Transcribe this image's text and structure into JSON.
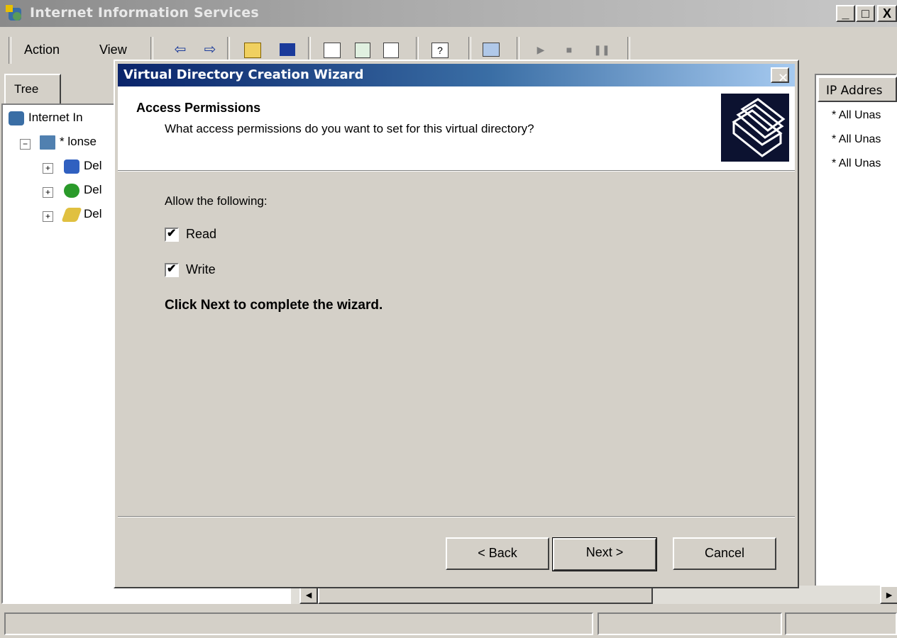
{
  "main_window": {
    "title": "Internet Information Services",
    "controls": {
      "minimize": "_",
      "maximize": "□",
      "close": "X"
    }
  },
  "menu": [
    {
      "label": "Action"
    },
    {
      "label": "View"
    }
  ],
  "toolbar_icons": [
    "back-arrow-icon",
    "forward-arrow-icon",
    "up-folder-icon",
    "show-hide-tree-icon",
    "properties-icon",
    "refresh-icon",
    "export-list-icon",
    "help-icon",
    "computer-icon",
    "play-icon",
    "stop-icon",
    "pause-icon"
  ],
  "tree": {
    "tab_label": "Tree",
    "items": [
      {
        "label": "Internet In",
        "icon": "iis-icon"
      },
      {
        "label": "* lonse",
        "icon": "computer-icon"
      },
      {
        "label": "Del",
        "icon": "ftp-site-icon"
      },
      {
        "label": "Del",
        "icon": "web-site-icon"
      },
      {
        "label": "Del",
        "icon": "smtp-icon"
      }
    ]
  },
  "list": {
    "header": "IP Addres",
    "rows": [
      "* All Unas",
      "* All Unas",
      "* All Unas"
    ]
  },
  "dialog": {
    "title": "Virtual Directory Creation Wizard",
    "close": "✕",
    "heading": "Access Permissions",
    "subheading": "What access permissions do you want to set for this virtual directory?",
    "graphic": "folders-icon",
    "allow_label": "Allow the following:",
    "options": [
      {
        "label": "Read",
        "checked": true,
        "mark": "✔"
      },
      {
        "label": "Write",
        "checked": true,
        "mark": "✔"
      }
    ],
    "finish_text": "Click Next to complete the wizard.",
    "buttons": {
      "back": "< Back",
      "next": "Next >",
      "cancel": "Cancel"
    }
  },
  "scrollbar": {
    "left": "◄",
    "right": "►"
  },
  "colors": {
    "title_active": "#0a246a",
    "title_gradient_end": "#a6caf0",
    "face": "#d4d0c8"
  }
}
